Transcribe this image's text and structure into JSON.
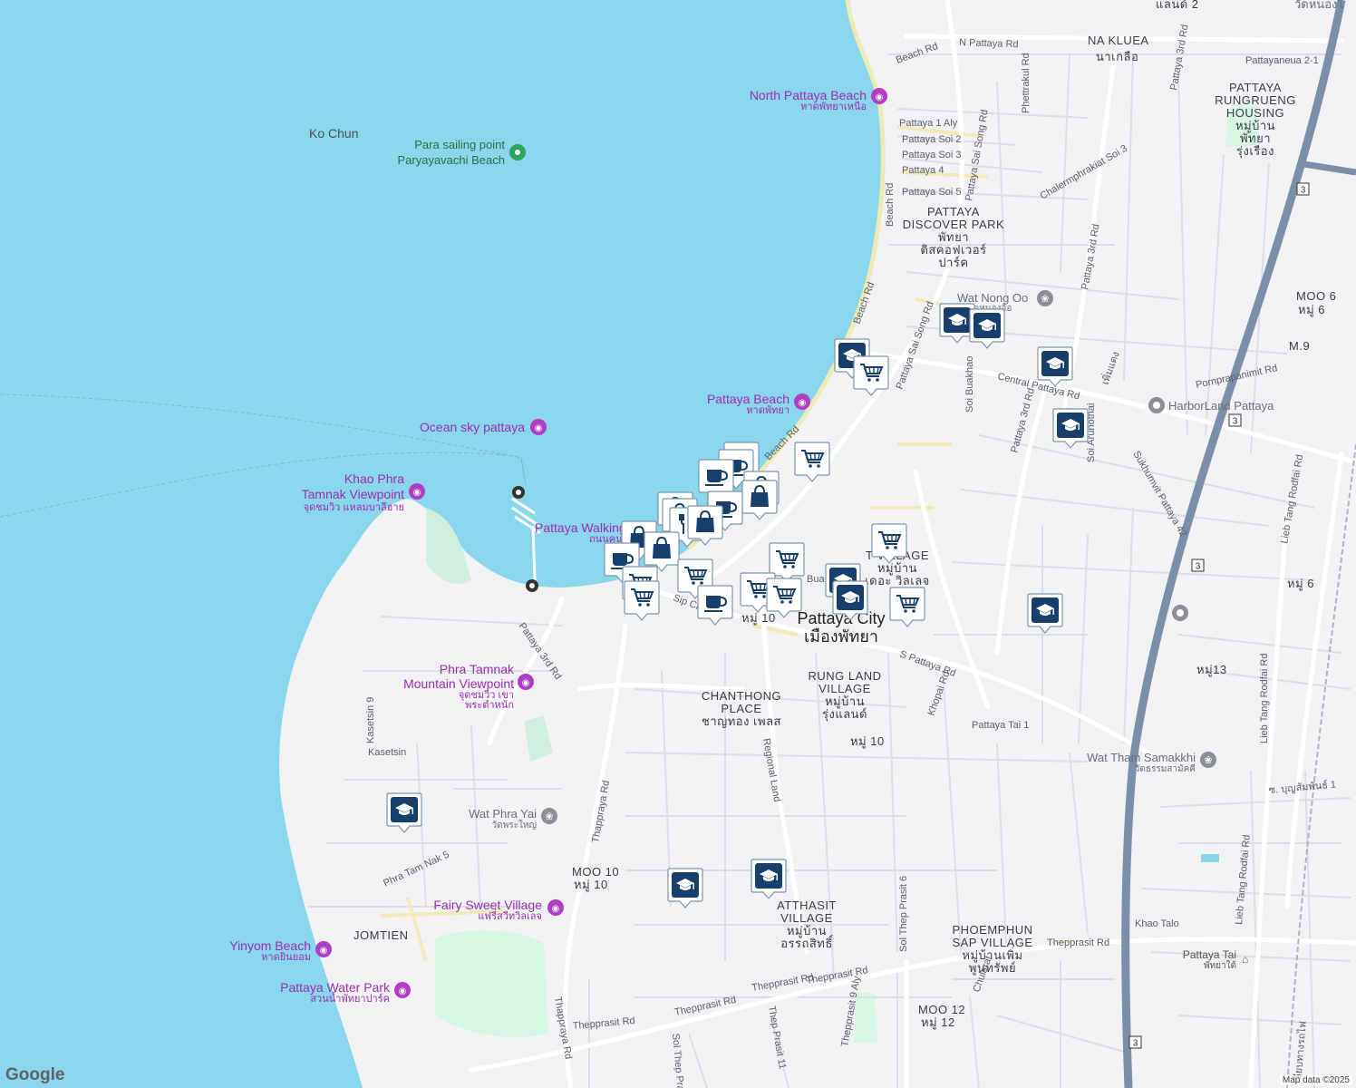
{
  "map": {
    "labels": {
      "ko_chun": "Ko Chun",
      "na_kluea": "NA KLUEA",
      "na_kluea_th": "นาเกลือ",
      "rungrueang_1": "PATTAYA",
      "rungrueang_2": "RUNGRUENG",
      "rungrueang_3": "HOUSING",
      "rungrueang_th1": "หมู่บ้าน",
      "rungrueang_th2": "พัทยา",
      "rungrueang_th3": "รุ่งเรือง",
      "discover_1": "PATTAYA",
      "discover_2": "DISCOVER PARK",
      "discover_th1": "พัทยา",
      "discover_th2": "ดิสคอฟเวอร์",
      "discover_th3": "ปาร์ค",
      "moo6_top": "MOO 6",
      "moo6_top_th": "หมู่ 6",
      "m9": "M.9",
      "moo6_right": "หมู่ 6",
      "moo13": "หมู่13",
      "village_1": "T  VILLAGE",
      "village_th1": "หมู่บ้าน",
      "village_th2": "เดอะ วิลเลจ",
      "pattaya_city": "Pattaya City",
      "pattaya_city_th": "เมืองพัทยา",
      "rungland_1": "RUNG LAND",
      "rungland_2": "VILLAGE",
      "rungland_th1": "หมู่บ้าน",
      "rungland_th2": "รุ่งแลนด์",
      "chanthong_1": "CHANTHONG",
      "chanthong_2": "PLACE",
      "chanthong_th": "ชาญทอง เพลส",
      "moo10_mid": "หมู่ 10",
      "moo10_center": "หมู่ 10",
      "moo10_en": "MOO 10",
      "moo10_th": "หมู่ 10",
      "atthasit_1": "ATTHASIT",
      "atthasit_2": "VILLAGE",
      "atthasit_th1": "หมู่บ้าน",
      "atthasit_th2": "อรรถสิทธิ์",
      "phoemphun_1": "PHOEMPHUN",
      "phoemphun_2": "SAP VILLAGE",
      "phoemphun_th1": "หมู่บ้านเพิ่ม",
      "phoemphun_th2": "พูนทรัพย์",
      "moo12_en": "MOO 12",
      "moo12_th": "หมู่ 12",
      "jomtien": "JOMTIEN",
      "kasetsin": "Kasetsin",
      "top_right_1": "แลนด์ 2",
      "top_right_2": "วัดหนองใ"
    },
    "roads": {
      "n_pattaya_rd": "N Pattaya Rd",
      "beach_rd_1": "Beach Rd",
      "beach_rd_2": "Beach Rd",
      "beach_rd_3": "Beach Rd",
      "beach_rd_4": "Beach Rd",
      "phettrakul": "Phettrakul Rd",
      "pattaya_3rd_1": "Pattaya 3rd Rd",
      "pattaya_3rd_2": "Pattaya 3rd Rd",
      "pattaya_3rd_3": "Pattaya 3rd Rd",
      "pattaya_3rd_sw": "Pattaya 3rd Rd",
      "pattayaneua": "Pattayaneua 2-1",
      "pattaya_1_aly": "Pattaya 1 Aly",
      "soi2": "Pattaya Soi 2",
      "soi3": "Pattaya Soi 3",
      "soi4": "Pattaya 4",
      "soi5": "Pattaya Soi 5",
      "sai_song_1": "Pattaya Sai Song Rd",
      "sai_song_2": "Pattaya Sai Song Rd",
      "chalerm": "Chalermphrakiat Soi 3",
      "central": "Central Pattaya Rd",
      "soi_buakhao": "Soi Buakhao",
      "soi_arunothai": "Soi Arunothai",
      "sukhumvit42": "Sukhumvit Pattaya 42",
      "pornpra": "Pornprapanimit Rd",
      "lieb_1": "Lieb Tang Rodfai Rd",
      "lieb_2": "Lieb Tang Rodfai Rd",
      "lieb_3": "Lieb Tang Rodfai Rd",
      "s_pattaya": "S Pattaya Rd",
      "khopai": "Khopai Rd",
      "pattaya_tai_1": "Pattaya Tai 1",
      "regional_land": "Regional Land",
      "thappraya_1": "Thappraya Rd",
      "thappraya_2": "Thappraya Rd",
      "kasetsin9": "Kasetsin 9",
      "phra_tam_nak5": "Phra Tam Nak 5",
      "sol_thep_prasit6": "Sol Thep Prasit 6",
      "thepprasit_1": "Thepprasit Rd",
      "thepprasit_2": "Thepprasit Rd",
      "thepprasit_3": "Thepprasit Rd",
      "thepprasit_4": "Thepprasit Rd",
      "thepprasit_5": "Thepprasit Rd",
      "khao_talo": "Khao Talo",
      "chularat": "Chularat",
      "thep_prasit_11": "Thep Prasit 11",
      "thepprasit_9": "Thepprasit 9 Aly",
      "sol_thep_prasa": "Sol Thep Prasa",
      "sip_cha": "Sip Ch",
      "bua": "Bua",
      "buncha": "ซ. บุญสัมพันธ์ 1",
      "phet_rd": "เพิ่มแดง",
      "rail_th": "เลียบทางรถไฟ",
      "shield_3": "3"
    },
    "pois": {
      "north_beach": "North Pattaya Beach",
      "north_beach_th": "หาดพัทยาเหนือ",
      "para_1": "Para sailing point",
      "para_2": "Paryayavachi Beach",
      "wat_nong_oo": "Wat Nong Oo",
      "wat_nong_oo_th": "วัดหนองอ้อ",
      "harborland": "HarborLand Pattaya",
      "pattaya_beach": "Pattaya Beach",
      "pattaya_beach_th": "หาดพัทยา",
      "ocean_sky": "Ocean sky pattaya",
      "khao_phra_1": "Khao Phra",
      "khao_phra_2": "Tamnak Viewpoint",
      "khao_phra_th": "จุดชมวิว แหลมบาลีฮาย",
      "walking": "Pattaya Walking",
      "walking_th": "ถนนคน",
      "phra_tamnak_1": "Phra Tamnak",
      "phra_tamnak_2": "Mountain Viewpoint",
      "phra_tamnak_th1": "จุดชมวิว เขา",
      "phra_tamnak_th2": "พระตำหนัก",
      "wat_tham": "Wat Tham Samakkhi",
      "wat_tham_th": "วัดธรรมสามัคคี",
      "wat_phra_yai": "Wat Phra Yai",
      "wat_phra_yai_th": "วัดพระใหญ่",
      "fairy": "Fairy Sweet Village",
      "fairy_th": "แฟรี่สวีทวิลเลจ",
      "yinyom": "Yinyom Beach",
      "yinyom_th": "หาดยินยอม",
      "water_park": "Pattaya Water Park",
      "water_park_th": "สวนน้ำพัทยาปาร์ค",
      "pattaya_tai": "Pattaya Tai",
      "pattaya_tai_th": "พัทยาใต้"
    },
    "colors": {
      "water": "#8ad6ec",
      "land": "#f2f2f4",
      "park": "#cfeedd",
      "road": "#ffffff",
      "highway": "#7d8ea8",
      "pin": "#163f6b",
      "poi": "#9b2fb0"
    },
    "pin_icons": [
      "school-icon",
      "cart-icon",
      "cup-icon",
      "bag-icon",
      "fork-knife-icon"
    ]
  },
  "footer": {
    "logo": "Google",
    "attribution": "Map data ©2025"
  }
}
